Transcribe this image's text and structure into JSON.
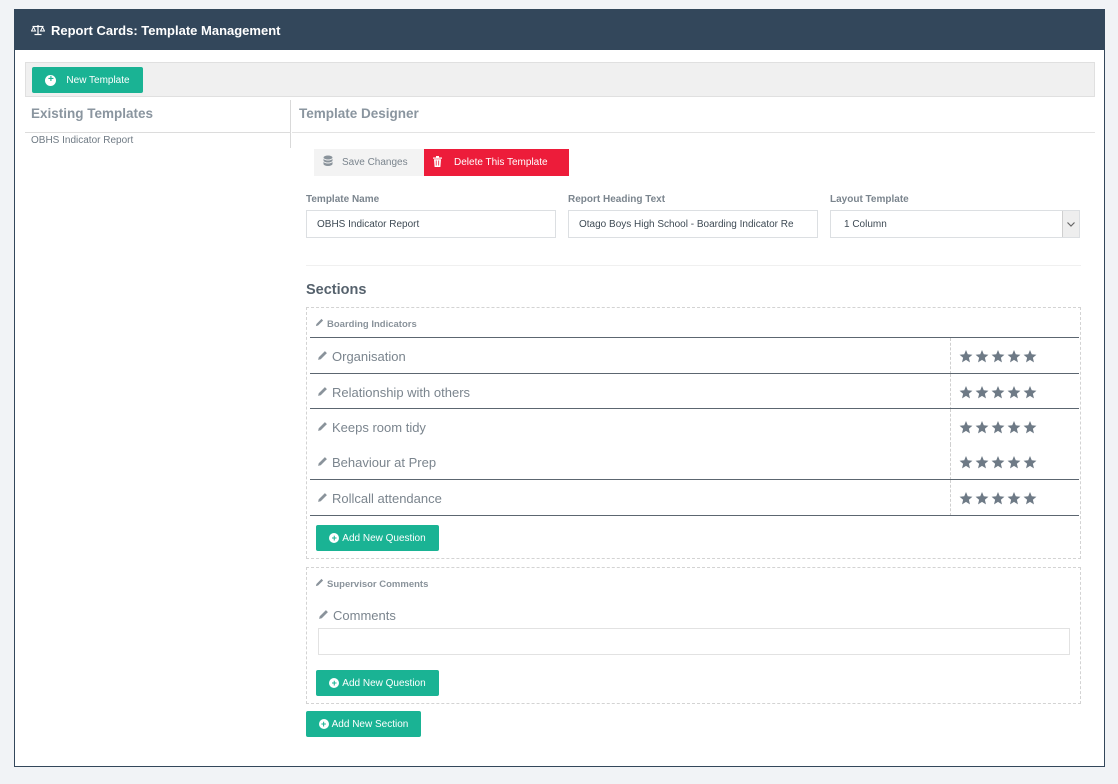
{
  "header": {
    "title": "Report Cards: Template Management",
    "icon": "balance-scale-icon"
  },
  "toolbar": {
    "new_template_label": "New Template"
  },
  "existing": {
    "heading": "Existing Templates",
    "items": [
      "OBHS Indicator Report"
    ]
  },
  "designer": {
    "heading": "Template Designer",
    "save_label": "Save Changes",
    "delete_label": "Delete This Template",
    "fields": {
      "template_name_label": "Template Name",
      "template_name_value": "OBHS Indicator Report",
      "heading_text_label": "Report Heading Text",
      "heading_text_value": "Otago Boys High School - Boarding Indicator Re",
      "layout_label": "Layout Template",
      "layout_value": "1 Column"
    }
  },
  "sections": {
    "heading": "Sections",
    "items": [
      {
        "title": "Boarding Indicators",
        "questions": [
          "Organisation",
          "Relationship with others",
          "Keeps room tidy",
          "Behaviour at Prep",
          "Rollcall attendance"
        ],
        "rating_stars": 5,
        "add_question_label": "Add New Question"
      },
      {
        "title": "Supervisor Comments",
        "comment_question": "Comments",
        "add_question_label": "Add New Question"
      }
    ],
    "add_section_label": "Add New Section"
  },
  "colors": {
    "header_bg": "#33475b",
    "accent_green": "#1ab394",
    "danger_red": "#ed1c3a",
    "star_gray": "#6e7a86"
  }
}
